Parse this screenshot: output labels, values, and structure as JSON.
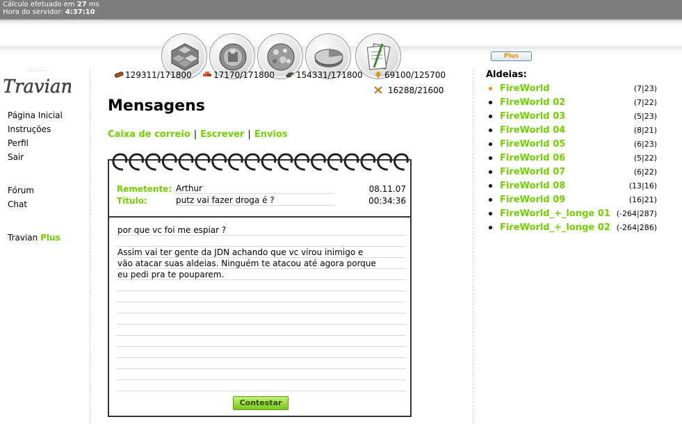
{
  "status": {
    "calc_prefix": "Cálculo efetuado em ",
    "calc_ms": "27",
    "calc_suffix": " ms",
    "server_prefix": "Hora do servidor: ",
    "server_time": "4:37:10"
  },
  "nav": {
    "icons": [
      "village-overview-icon",
      "village-center-icon",
      "map-icon",
      "statistics-icon",
      "reports-messages-icon"
    ],
    "plus_label": "Plus"
  },
  "logo_alt": "Travian",
  "left_links": {
    "home": "Página Inicial",
    "instructions": "Instruções",
    "profile": "Perfil",
    "logout": "Sair",
    "forum": "Fórum",
    "chat": "Chat",
    "travian_plus_prefix": "Travian ",
    "travian_plus_suffix": "Plus"
  },
  "resources": {
    "wood": "129311/171800",
    "clay": "17170/171800",
    "iron": "154331/171800",
    "crop": "69100/125700",
    "crop_consumption": "16288/21600"
  },
  "page_title": "Mensagens",
  "tabs": {
    "inbox": "Caixa de correio",
    "write": "Escrever",
    "sent": "Envios"
  },
  "message": {
    "sender_label": "Remetente:",
    "sender": "Arthur",
    "subject_label": "Título:",
    "subject": "putz vai fazer droga é ?",
    "date": "08.11.07",
    "time": "00:34:36",
    "body_lines": [
      "por que vc foi me espiar ?",
      "",
      "Assim vai ter gente da JDN achando que vc virou inimigo e",
      "vão atacar suas aldeias. Ninguém te atacou até agora porque",
      "eu pedi pra te pouparem."
    ],
    "reply_label": "Contestar"
  },
  "villages": {
    "title": "Aldeias:",
    "items": [
      {
        "name": "FireWorld",
        "coords": "(7|23)"
      },
      {
        "name": "FireWorld 02",
        "coords": "(7|22)"
      },
      {
        "name": "FireWorld 03",
        "coords": "(5|23)"
      },
      {
        "name": "FireWorld 04",
        "coords": "(8|21)"
      },
      {
        "name": "FireWorld 05",
        "coords": "(6|23)"
      },
      {
        "name": "FireWorld 06",
        "coords": "(5|22)"
      },
      {
        "name": "FireWorld 07",
        "coords": "(6|22)"
      },
      {
        "name": "FireWorld 08",
        "coords": "(13|16)"
      },
      {
        "name": "FireWorld 09",
        "coords": "(16|21)"
      },
      {
        "name": "FireWorld_+_longe 01",
        "coords": "(-264|287)"
      },
      {
        "name": "FireWorld_+_longe 02",
        "coords": "(-264|286)"
      }
    ]
  },
  "colors": {
    "accent_green": "#71d000",
    "active_village": "#ff8a00",
    "topbar": "#7d7d7d"
  }
}
